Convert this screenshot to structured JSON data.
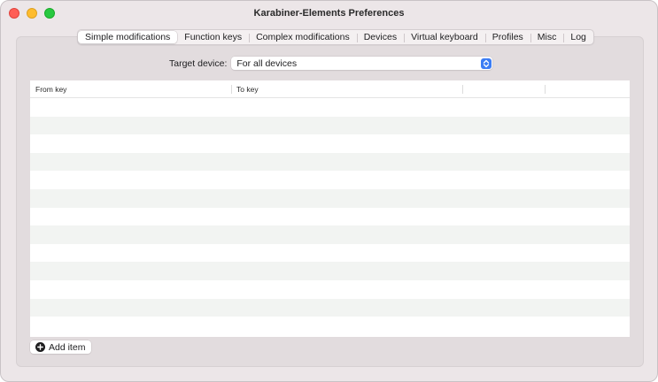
{
  "window": {
    "title": "Karabiner-Elements Preferences"
  },
  "tabs": [
    {
      "label": "Simple modifications",
      "active": true
    },
    {
      "label": "Function keys",
      "active": false
    },
    {
      "label": "Complex modifications",
      "active": false
    },
    {
      "label": "Devices",
      "active": false
    },
    {
      "label": "Virtual keyboard",
      "active": false
    },
    {
      "label": "Profiles",
      "active": false
    },
    {
      "label": "Misc",
      "active": false
    },
    {
      "label": "Log",
      "active": false
    }
  ],
  "target": {
    "label": "Target device:",
    "selected": "For all devices"
  },
  "table": {
    "columns": [
      "From key",
      "To key",
      "",
      ""
    ],
    "row_count": 13
  },
  "actions": {
    "add_label": "Add item"
  },
  "colors": {
    "accent": "#3b7cf4",
    "close": "#ff5f57",
    "minimize": "#febc2e",
    "maximize": "#28c840"
  }
}
